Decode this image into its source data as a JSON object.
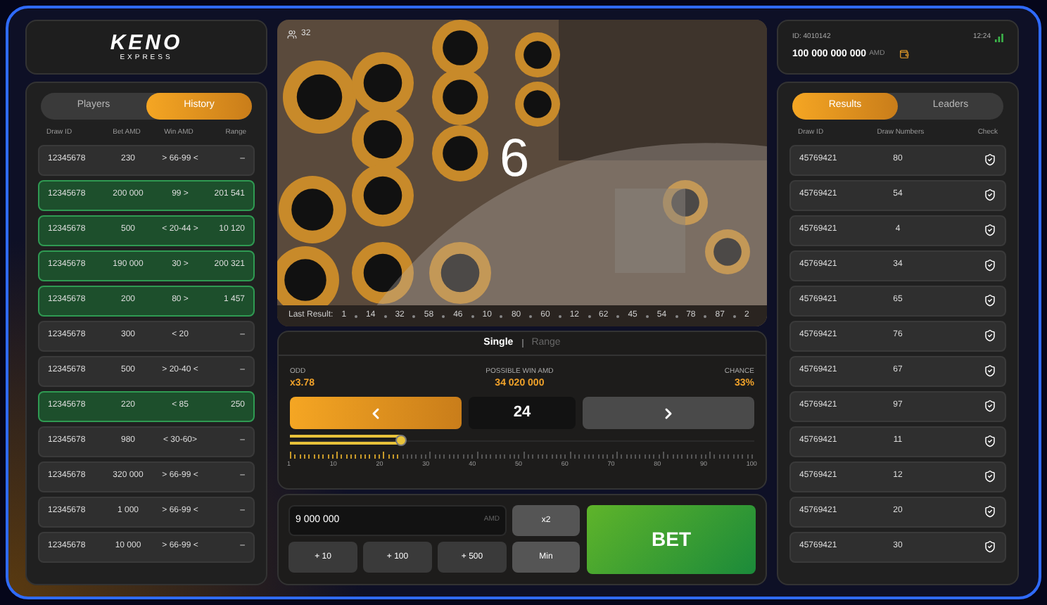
{
  "logo": {
    "title": "KENO",
    "subtitle": "EXPRESS"
  },
  "left_panel": {
    "tabs": [
      {
        "label": "Players",
        "selected": false
      },
      {
        "label": "History",
        "selected": true
      }
    ],
    "columns": [
      "Draw ID",
      "Bet AMD",
      "Win AMD",
      "Range"
    ],
    "rows": [
      {
        "cells": [
          "12345678",
          "230",
          "> 66-99 <",
          "–"
        ],
        "won": false
      },
      {
        "cells": [
          "12345678",
          "200 000",
          "99 >",
          "201 541"
        ],
        "won": true
      },
      {
        "cells": [
          "12345678",
          "500",
          "< 20-44 >",
          "10 120"
        ],
        "won": true
      },
      {
        "cells": [
          "12345678",
          "190 000",
          "30 >",
          "200 321"
        ],
        "won": true
      },
      {
        "cells": [
          "12345678",
          "200",
          "80 >",
          "1 457"
        ],
        "won": true
      },
      {
        "cells": [
          "12345678",
          "300",
          "< 20",
          "–"
        ],
        "won": false
      },
      {
        "cells": [
          "12345678",
          "500",
          "> 20-40 <",
          "–"
        ],
        "won": false
      },
      {
        "cells": [
          "12345678",
          "220",
          "< 85",
          "250"
        ],
        "won": true
      },
      {
        "cells": [
          "12345678",
          "980",
          "< 30-60>",
          "–"
        ],
        "won": false
      },
      {
        "cells": [
          "12345678",
          "320 000",
          "> 66-99 <",
          "–"
        ],
        "won": false
      },
      {
        "cells": [
          "12345678",
          "1 000",
          "> 66-99 <",
          "–"
        ],
        "won": false
      },
      {
        "cells": [
          "12345678",
          "10 000",
          "> 66-99 <",
          "–"
        ],
        "won": false
      }
    ]
  },
  "video": {
    "viewers": "32",
    "drawn_number": "6",
    "last_result": {
      "label": "Last Result:",
      "numbers": [
        "1",
        "14",
        "32",
        "58",
        "46",
        "10",
        "80",
        "60",
        "12",
        "62",
        "45",
        "54",
        "78",
        "87",
        "2"
      ]
    }
  },
  "controls": {
    "mode_tabs": [
      {
        "label": "Single",
        "selected": true
      },
      {
        "label": "Range",
        "selected": false
      }
    ],
    "stats": [
      {
        "label": "ODD",
        "value": "x3.78"
      },
      {
        "label": "POSSIBLE WIN AMD",
        "value": "34 020 000"
      },
      {
        "label": "CHANCE",
        "value": "33%"
      }
    ],
    "number": "24",
    "prev_active": true,
    "slider": {
      "level": 0.24,
      "ticks": [
        "1",
        "10",
        "20",
        "30",
        "40",
        "50",
        "60",
        "70",
        "80",
        "90",
        "100"
      ]
    }
  },
  "bet": {
    "amount": "9 000 000",
    "currency": "AMD",
    "buttons": [
      "x2",
      "+ 10",
      "+ 100",
      "+ 500",
      "Min"
    ],
    "bet_label": "BET"
  },
  "account": {
    "id": "ID: 4010142",
    "time": "12:24",
    "balance": "100 000 000 000",
    "currency": "AMD"
  },
  "right_panel": {
    "tabs": [
      {
        "label": "Results",
        "selected": true
      },
      {
        "label": "Leaders",
        "selected": false
      }
    ],
    "columns": [
      "Draw ID",
      "Draw Numbers",
      "Check"
    ],
    "rows": [
      {
        "draw_id": "45769421",
        "number": "80"
      },
      {
        "draw_id": "45769421",
        "number": "54"
      },
      {
        "draw_id": "45769421",
        "number": "4"
      },
      {
        "draw_id": "45769421",
        "number": "34"
      },
      {
        "draw_id": "45769421",
        "number": "65"
      },
      {
        "draw_id": "45769421",
        "number": "76"
      },
      {
        "draw_id": "45769421",
        "number": "67"
      },
      {
        "draw_id": "45769421",
        "number": "97"
      },
      {
        "draw_id": "45769421",
        "number": "11"
      },
      {
        "draw_id": "45769421",
        "number": "12"
      },
      {
        "draw_id": "45769421",
        "number": "20"
      },
      {
        "draw_id": "45769421",
        "number": "30"
      }
    ]
  }
}
